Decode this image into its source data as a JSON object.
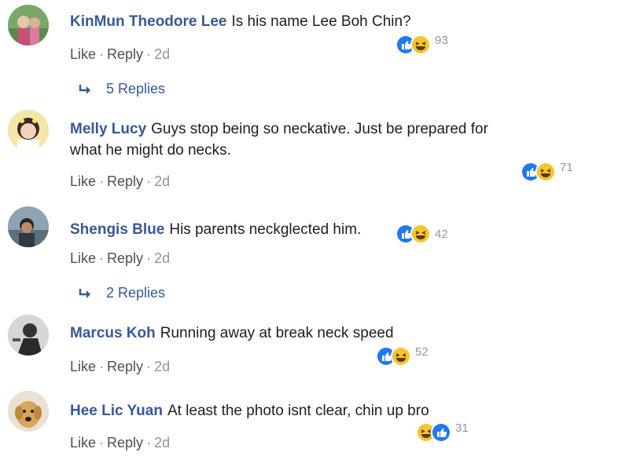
{
  "comments": [
    {
      "author": "KinMun Theodore Lee",
      "text": "Is his name Lee Boh Chin?",
      "like": "Like",
      "reply": "Reply",
      "sep": "·",
      "age": "2d",
      "reactions": "93",
      "replies": "5 Replies"
    },
    {
      "author": "Melly Lucy",
      "text": "Guys stop being so neckative. Just be prepared for",
      "text2": "what he might do necks.",
      "like": "Like",
      "reply": "Reply",
      "sep": "·",
      "age": "2d",
      "reactions": "71"
    },
    {
      "author": "Shengis Blue",
      "text": "His parents neckglected him.",
      "like": "Like",
      "reply": "Reply",
      "sep": "·",
      "age": "2d",
      "reactions": "42",
      "replies": "2 Replies"
    },
    {
      "author": "Marcus Koh",
      "text": "Running away at break neck speed",
      "like": "Like",
      "reply": "Reply",
      "sep": "·",
      "age": "2d",
      "reactions": "52"
    },
    {
      "author": "Hee Lic Yuan",
      "text": "At least the photo isnt clear, chin up bro",
      "like": "Like",
      "reply": "Reply",
      "sep": "·",
      "age": "2d",
      "reactions": "31"
    }
  ],
  "icons": {
    "like": "like-reaction-icon",
    "haha": "haha-reaction-icon",
    "reply_arrow": "reply-arrow-icon"
  },
  "colors": {
    "link": "#385898",
    "meta": "#90949c",
    "like_blue": "#2078f4",
    "haha_yellow": "#f7c52b"
  }
}
